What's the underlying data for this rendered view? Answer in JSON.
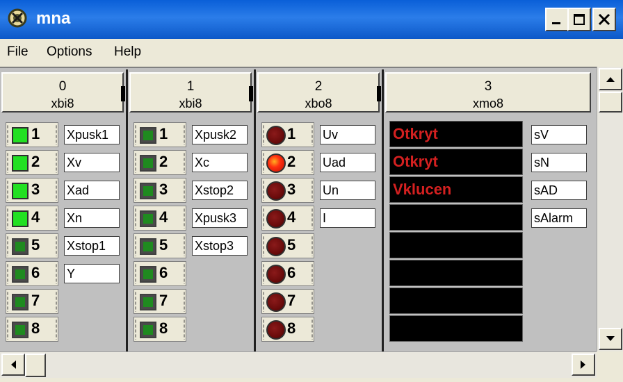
{
  "window": {
    "title": "mna"
  },
  "menu": {
    "file": "File",
    "options": "Options",
    "help": "Help"
  },
  "colors": {
    "led_on_green": "#22e022",
    "led_off_green": "#1f8a1f",
    "led_off_red": "#6a0b0b",
    "led_on_red": "#ff3010",
    "display_text": "#d42020"
  },
  "modules": [
    {
      "number": "0",
      "type": "xbi8",
      "led_style": "green-square",
      "channels": [
        {
          "num": "1",
          "on": true,
          "signal": "Xpusk1"
        },
        {
          "num": "2",
          "on": true,
          "signal": "Xv"
        },
        {
          "num": "3",
          "on": true,
          "signal": "Xad"
        },
        {
          "num": "4",
          "on": true,
          "signal": "Xn"
        },
        {
          "num": "5",
          "on": false,
          "signal": "Xstop1"
        },
        {
          "num": "6",
          "on": false,
          "signal": "Y"
        },
        {
          "num": "7",
          "on": false,
          "signal": ""
        },
        {
          "num": "8",
          "on": false,
          "signal": ""
        }
      ]
    },
    {
      "number": "1",
      "type": "xbi8",
      "led_style": "green-square",
      "channels": [
        {
          "num": "1",
          "on": false,
          "signal": "Xpusk2"
        },
        {
          "num": "2",
          "on": false,
          "signal": "Xc"
        },
        {
          "num": "3",
          "on": false,
          "signal": "Xstop2"
        },
        {
          "num": "4",
          "on": false,
          "signal": "Xpusk3"
        },
        {
          "num": "5",
          "on": false,
          "signal": "Xstop3"
        },
        {
          "num": "6",
          "on": false,
          "signal": ""
        },
        {
          "num": "7",
          "on": false,
          "signal": ""
        },
        {
          "num": "8",
          "on": false,
          "signal": ""
        }
      ]
    },
    {
      "number": "2",
      "type": "xbo8",
      "led_style": "red-round",
      "channels": [
        {
          "num": "1",
          "on": false,
          "signal": "Uv"
        },
        {
          "num": "2",
          "on": true,
          "signal": "Uad"
        },
        {
          "num": "3",
          "on": false,
          "signal": "Un"
        },
        {
          "num": "4",
          "on": false,
          "signal": "I"
        },
        {
          "num": "5",
          "on": false,
          "signal": ""
        },
        {
          "num": "6",
          "on": false,
          "signal": ""
        },
        {
          "num": "7",
          "on": false,
          "signal": ""
        },
        {
          "num": "8",
          "on": false,
          "signal": ""
        }
      ]
    },
    {
      "number": "3",
      "type": "xmo8",
      "displays": [
        "Otkryt",
        "Otkryt",
        "Vklucen",
        "",
        "",
        "",
        "",
        ""
      ],
      "signals": [
        "sV",
        "sN",
        "sAD",
        "sAlarm"
      ]
    }
  ]
}
